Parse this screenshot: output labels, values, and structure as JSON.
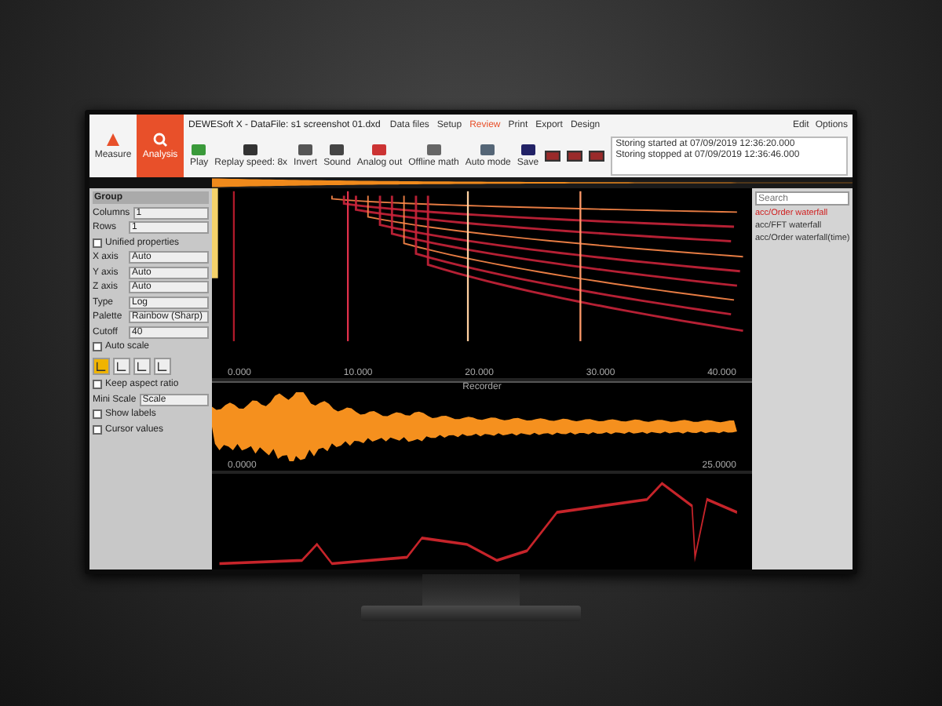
{
  "window": {
    "title": "DEWESoft X - DataFile: s1 screenshot 01.dxd"
  },
  "modes": [
    {
      "label": "Measure",
      "selected": false
    },
    {
      "label": "Analysis",
      "selected": true
    }
  ],
  "ribbon_tabs": [
    {
      "label": "Data files",
      "selected": false
    },
    {
      "label": "Setup",
      "selected": false
    },
    {
      "label": "Review",
      "selected": true
    },
    {
      "label": "Print",
      "selected": false
    },
    {
      "label": "Export",
      "selected": false
    },
    {
      "label": "Design",
      "selected": false
    }
  ],
  "toolbar": [
    {
      "label": "Play"
    },
    {
      "label": "Replay speed: 8x"
    },
    {
      "label": "Invert"
    },
    {
      "label": "Sound"
    },
    {
      "label": "Analog out"
    },
    {
      "label": "Offline math"
    },
    {
      "label": "Auto mode"
    },
    {
      "label": "Save"
    }
  ],
  "window_actions": [
    {
      "label": "Edit"
    },
    {
      "label": "Options"
    }
  ],
  "log": [
    "Storing started at 07/09/2019 12:36:20.000",
    "Storing stopped at 07/09/2019 12:36:46.000"
  ],
  "left_panel": {
    "title": "Group",
    "rows": [
      {
        "kind": "field",
        "label": "Columns",
        "value": "1"
      },
      {
        "kind": "field",
        "label": "Rows",
        "value": "1"
      },
      {
        "kind": "check",
        "label": "Unified properties",
        "checked": false
      },
      {
        "kind": "field",
        "label": "X axis",
        "value": "Auto"
      },
      {
        "kind": "field",
        "label": "Y axis",
        "value": "Auto"
      },
      {
        "kind": "field",
        "label": "Z axis",
        "value": "Auto"
      },
      {
        "kind": "field",
        "label": "Type",
        "value": "Log"
      },
      {
        "kind": "field",
        "label": "Palette",
        "value": "Rainbow (Sharp)"
      },
      {
        "kind": "field",
        "label": "Cutoff",
        "value": "40"
      },
      {
        "kind": "check",
        "label": "Auto scale",
        "checked": false
      },
      {
        "kind": "check",
        "label": "Keep aspect ratio",
        "checked": false
      },
      {
        "kind": "field",
        "label": "Mini Scale",
        "value": "Scale"
      },
      {
        "kind": "check",
        "label": "Show labels",
        "checked": false
      },
      {
        "kind": "check",
        "label": "Cursor values",
        "checked": false
      }
    ]
  },
  "view_modes": [
    {
      "selected": true
    },
    {
      "selected": false
    },
    {
      "selected": false
    },
    {
      "selected": false
    }
  ],
  "spectrogram": {
    "x_ticks": [
      "0.000",
      "10.000",
      "20.000",
      "30.000",
      "40.000"
    ]
  },
  "waveform": {
    "title": "Recorder",
    "start": "0.0000",
    "end": "25.0000"
  },
  "right_panel": {
    "search": {
      "placeholder": "Search"
    },
    "items": [
      {
        "label": "acc/Order waterfall",
        "selected": true
      },
      {
        "label": "acc/FFT waterfall",
        "selected": false
      },
      {
        "label": "acc/Order waterfall(time)",
        "selected": false
      }
    ]
  }
}
